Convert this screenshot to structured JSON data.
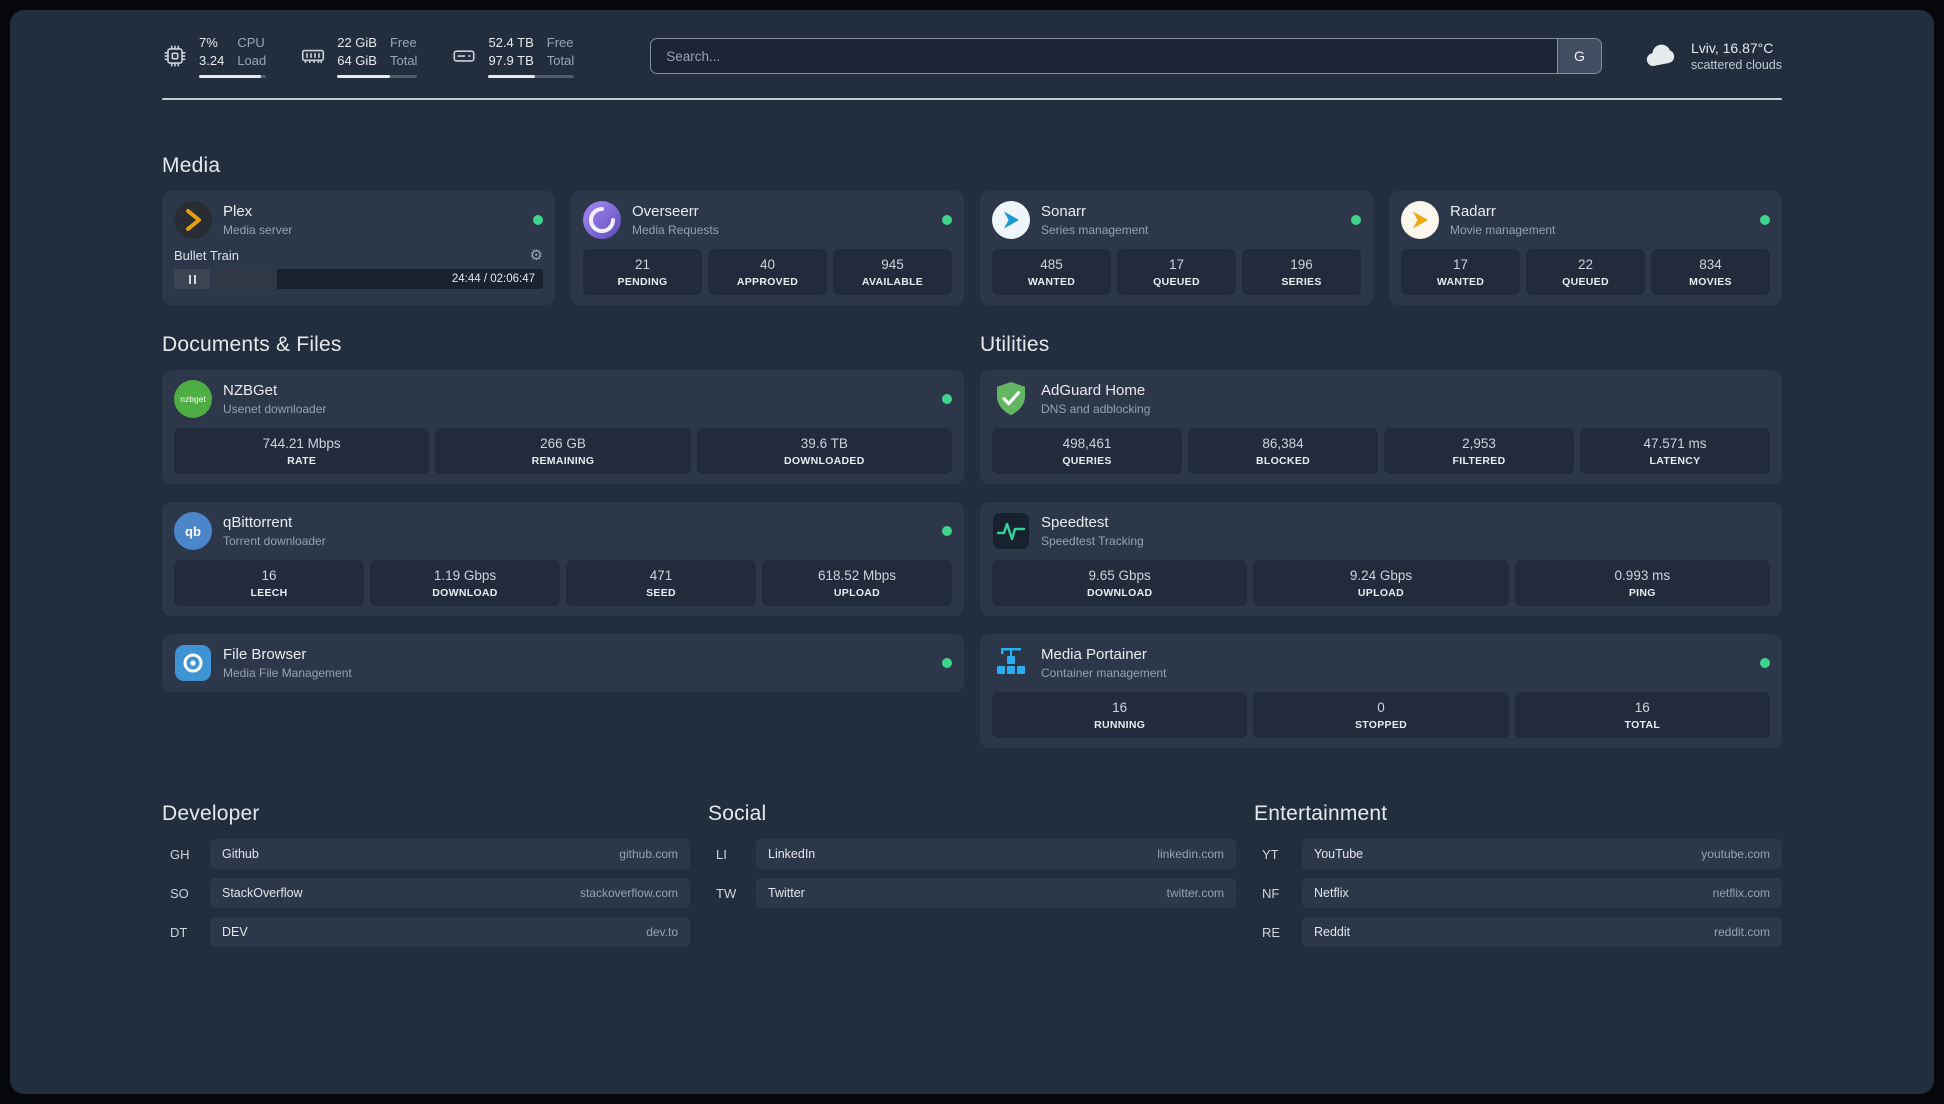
{
  "colors": {
    "status_online": "#3ed58c",
    "plex_amber": "#e5a00d",
    "page_bg": "#222d3e",
    "card_bg": "#2c3749",
    "stat_bg": "#212b3c"
  },
  "topbar": {
    "resources": [
      {
        "icon": "cpu-icon",
        "values": [
          "7%",
          "3.24"
        ],
        "labels": [
          "CPU",
          "Load"
        ],
        "bar": "92%"
      },
      {
        "icon": "memory-icon",
        "values": [
          "22 GiB",
          "64 GiB"
        ],
        "labels": [
          "Free",
          "Total"
        ],
        "bar": "66%"
      },
      {
        "icon": "disk-icon",
        "values": [
          "52.4 TB",
          "97.9 TB"
        ],
        "labels": [
          "Free",
          "Total"
        ],
        "bar": "54%"
      }
    ],
    "search": {
      "placeholder": "Search...",
      "button_label": "G"
    },
    "weather": {
      "location": "Lviv, 16.87°C",
      "condition": "scattered clouds"
    }
  },
  "media": {
    "heading": "Media",
    "plex": {
      "title": "Plex",
      "subtitle": "Media server",
      "player": {
        "track": "Bullet Train",
        "time": "24:44 / 02:06:47",
        "progress": "19.5%"
      }
    },
    "overseerr": {
      "title": "Overseerr",
      "subtitle": "Media Requests",
      "stats": [
        {
          "value": "21",
          "label": "PENDING"
        },
        {
          "value": "40",
          "label": "APPROVED"
        },
        {
          "value": "945",
          "label": "AVAILABLE"
        }
      ]
    },
    "sonarr": {
      "title": "Sonarr",
      "subtitle": "Series management",
      "stats": [
        {
          "value": "485",
          "label": "WANTED"
        },
        {
          "value": "17",
          "label": "QUEUED"
        },
        {
          "value": "196",
          "label": "SERIES"
        }
      ]
    },
    "radarr": {
      "title": "Radarr",
      "subtitle": "Movie management",
      "stats": [
        {
          "value": "17",
          "label": "WANTED"
        },
        {
          "value": "22",
          "label": "QUEUED"
        },
        {
          "value": "834",
          "label": "MOVIES"
        }
      ]
    }
  },
  "documents": {
    "heading": "Documents & Files",
    "nzbget": {
      "title": "NZBGet",
      "subtitle": "Usenet downloader",
      "stats": [
        {
          "value": "744.21 Mbps",
          "label": "RATE"
        },
        {
          "value": "266 GB",
          "label": "REMAINING"
        },
        {
          "value": "39.6 TB",
          "label": "DOWNLOADED"
        }
      ]
    },
    "qbittorrent": {
      "title": "qBittorrent",
      "subtitle": "Torrent downloader",
      "stats": [
        {
          "value": "16",
          "label": "LEECH"
        },
        {
          "value": "1.19 Gbps",
          "label": "DOWNLOAD"
        },
        {
          "value": "471",
          "label": "SEED"
        },
        {
          "value": "618.52 Mbps",
          "label": "UPLOAD"
        }
      ]
    },
    "filebrowser": {
      "title": "File Browser",
      "subtitle": "Media File Management"
    }
  },
  "utilities": {
    "heading": "Utilities",
    "adguard": {
      "title": "AdGuard Home",
      "subtitle": "DNS and adblocking",
      "stats": [
        {
          "value": "498,461",
          "label": "QUERIES"
        },
        {
          "value": "86,384",
          "label": "BLOCKED"
        },
        {
          "value": "2,953",
          "label": "FILTERED"
        },
        {
          "value": "47.571 ms",
          "label": "LATENCY"
        }
      ]
    },
    "speedtest": {
      "title": "Speedtest",
      "subtitle": "Speedtest Tracking",
      "stats": [
        {
          "value": "9.65 Gbps",
          "label": "DOWNLOAD"
        },
        {
          "value": "9.24 Gbps",
          "label": "UPLOAD"
        },
        {
          "value": "0.993 ms",
          "label": "PING"
        }
      ]
    },
    "portainer": {
      "title": "Media Portainer",
      "subtitle": "Container management",
      "stats": [
        {
          "value": "16",
          "label": "RUNNING"
        },
        {
          "value": "0",
          "label": "STOPPED"
        },
        {
          "value": "16",
          "label": "TOTAL"
        }
      ]
    }
  },
  "bookmarks": {
    "developer": {
      "heading": "Developer",
      "items": [
        {
          "abbr": "GH",
          "name": "Github",
          "domain": "github.com"
        },
        {
          "abbr": "SO",
          "name": "StackOverflow",
          "domain": "stackoverflow.com"
        },
        {
          "abbr": "DT",
          "name": "DEV",
          "domain": "dev.to"
        }
      ]
    },
    "social": {
      "heading": "Social",
      "items": [
        {
          "abbr": "LI",
          "name": "LinkedIn",
          "domain": "linkedin.com"
        },
        {
          "abbr": "TW",
          "name": "Twitter",
          "domain": "twitter.com"
        }
      ]
    },
    "entertainment": {
      "heading": "Entertainment",
      "items": [
        {
          "abbr": "YT",
          "name": "YouTube",
          "domain": "youtube.com"
        },
        {
          "abbr": "NF",
          "name": "Netflix",
          "domain": "netflix.com"
        },
        {
          "abbr": "RE",
          "name": "Reddit",
          "domain": "reddit.com"
        }
      ]
    }
  }
}
